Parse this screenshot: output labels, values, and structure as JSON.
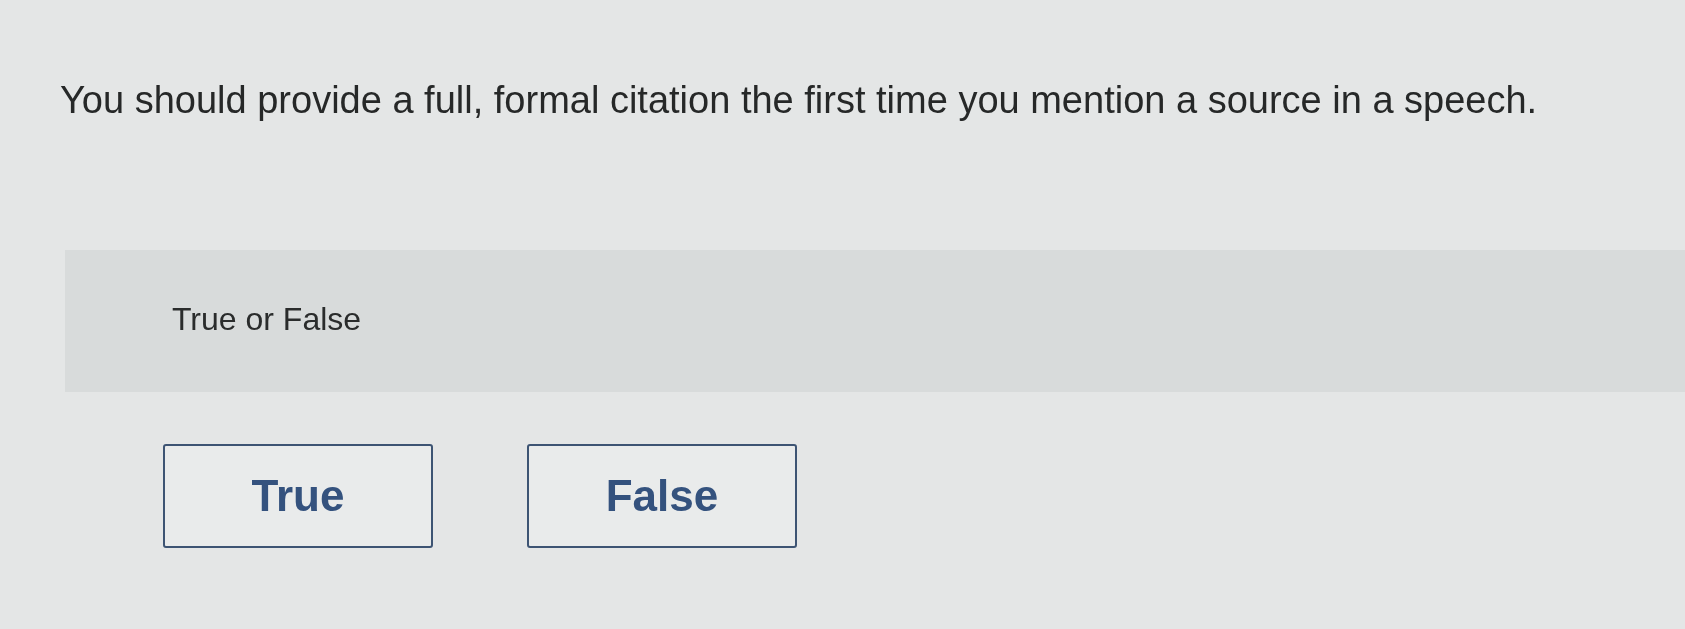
{
  "question": {
    "text": "You should provide a full, formal citation the first time you mention a source in a speech."
  },
  "answer_panel": {
    "prompt": "True or False"
  },
  "options": [
    {
      "label": "True",
      "selected": false
    },
    {
      "label": "False",
      "selected": false
    }
  ]
}
